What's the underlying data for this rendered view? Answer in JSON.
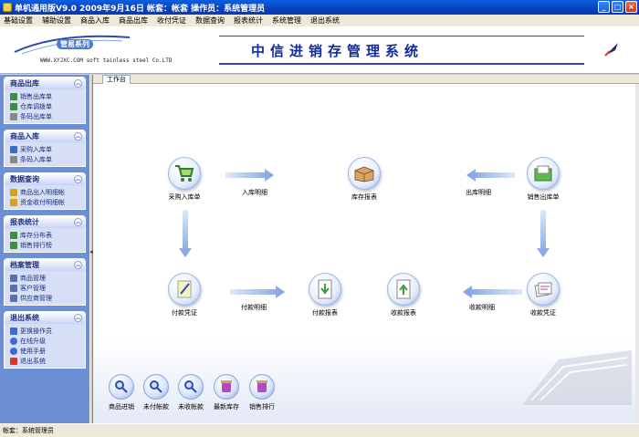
{
  "window": {
    "title": "单机通用版V9.0 2009年9月16日 帐套：帐套 操作员：系统管理员",
    "min": "_",
    "max": "□",
    "close": "×"
  },
  "menus": [
    "基础设置",
    "辅助设置",
    "商品入库",
    "商品出库",
    "收付凭证",
    "数据查询",
    "报表统计",
    "系统管理",
    "退出系统"
  ],
  "banner": {
    "brand": "管易系列",
    "company": "WWW.XYJXC.COM soft tainless steel Co.LTD",
    "title": "中信进销存管理系统"
  },
  "sidebar": {
    "panels": [
      {
        "title": "商品出库",
        "items": [
          {
            "label": "销售出库单",
            "icon": "doc-icon",
            "color": "#3c8d3c"
          },
          {
            "label": "仓库调拨单",
            "icon": "doc-icon",
            "color": "#3c8d3c"
          },
          {
            "label": "条码出库单",
            "icon": "doc-icon",
            "color": "#888888"
          }
        ]
      },
      {
        "title": "商品入库",
        "items": [
          {
            "label": "采购入库单",
            "icon": "doc-icon",
            "color": "#3a6bd0"
          },
          {
            "label": "条码入库单",
            "icon": "doc-icon",
            "color": "#888888"
          }
        ]
      },
      {
        "title": "数据查询",
        "items": [
          {
            "label": "商品出入明细帐",
            "icon": "people-icon",
            "color": "#d6a21a"
          },
          {
            "label": "资金收付明细帐",
            "icon": "people-icon",
            "color": "#d6a21a"
          }
        ]
      },
      {
        "title": "报表统计",
        "items": [
          {
            "label": "库存分布表",
            "icon": "chart-icon",
            "color": "#3c8d3c"
          },
          {
            "label": "销售排行榜",
            "icon": "chart-icon",
            "color": "#3c8d3c"
          }
        ]
      },
      {
        "title": "档案管理",
        "items": [
          {
            "label": "商品管理",
            "icon": "file-icon",
            "color": "#5b6fae"
          },
          {
            "label": "客户管理",
            "icon": "file-icon",
            "color": "#5b6fae"
          },
          {
            "label": "供应商管理",
            "icon": "file-icon",
            "color": "#5b6fae"
          }
        ]
      },
      {
        "title": "退出系统",
        "items": [
          {
            "label": "更换操作员",
            "icon": "user-icon",
            "color": "#3a6bd0"
          },
          {
            "label": "在线升级",
            "icon": "globe-icon",
            "color": "#3a6bd0"
          },
          {
            "label": "使用手册",
            "icon": "help-icon",
            "color": "#3a6bd0"
          },
          {
            "label": "退出系统",
            "icon": "exit-icon",
            "color": "#d43b2a"
          }
        ]
      }
    ]
  },
  "workspace": {
    "tab": "工作台",
    "nodes": {
      "purchase": "采购入库单",
      "stock_report": "库存报表",
      "sales_out": "销售出库单",
      "payment_voucher": "付款凭证",
      "payment_report": "付款报表",
      "receipt_report": "收款报表",
      "receipt_voucher": "收款凭证"
    },
    "arrows": {
      "in_detail": "入库明细",
      "out_detail": "出库明细",
      "pay_detail": "付款明细",
      "recv_detail": "收款明细"
    },
    "bottom": [
      "商品进销",
      "未付帐款",
      "未收帐款",
      "最新库存",
      "销售排行"
    ]
  },
  "status": "帐套：系统管理员"
}
